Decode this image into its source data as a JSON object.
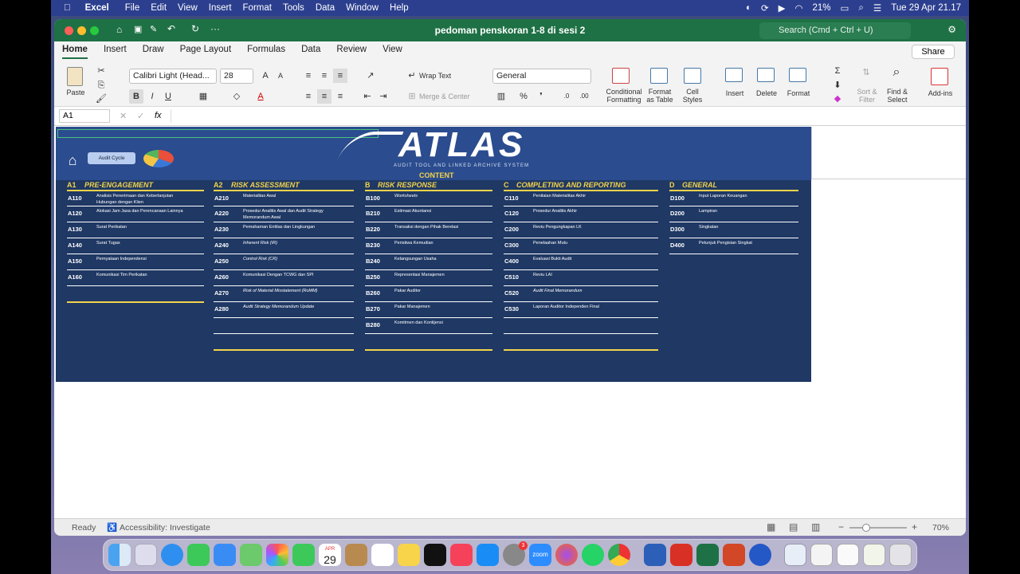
{
  "menubar": {
    "app": "Excel",
    "items": [
      "File",
      "Edit",
      "View",
      "Insert",
      "Format",
      "Tools",
      "Data",
      "Window",
      "Help"
    ],
    "battery": "21%",
    "datetime": "Tue 29 Apr  21.17"
  },
  "window": {
    "title": "pedoman penskoran 1-8 di sesi 2",
    "search_placeholder": "Search (Cmd + Ctrl + U)",
    "share": "Share"
  },
  "ribbon": {
    "tabs": [
      "Home",
      "Insert",
      "Draw",
      "Page Layout",
      "Formulas",
      "Data",
      "Review",
      "View"
    ],
    "paste": "Paste",
    "font": "Calibri Light (Head...",
    "size": "28",
    "wrap": "Wrap Text",
    "merge": "Merge & Center",
    "number_format": "General",
    "cond_fmt_1": "Conditional",
    "cond_fmt_2": "Formatting",
    "fmt_table_1": "Format",
    "fmt_table_2": "as Table",
    "cell_styles_1": "Cell",
    "cell_styles_2": "Styles",
    "insert": "Insert",
    "delete": "Delete",
    "format": "Format",
    "sort_1": "Sort &",
    "sort_2": "Filter",
    "find_1": "Find &",
    "find_2": "Select",
    "addins": "Add-ins"
  },
  "formula": {
    "cell": "A1",
    "fx": "fx"
  },
  "dashboard": {
    "logo": "ATLAS",
    "logo_sub": "AUDIT TOOL AND LINKED ARCHIVE SYSTEM",
    "content": "CONTENT",
    "audit_cycle": "Audit Cycle",
    "columns": [
      {
        "code": "A1",
        "title": "PRE-ENGAGEMENT",
        "rows": [
          [
            "A110",
            "Analisis Penerimaan dan Keberlanjutan Hubungan dengan Klien"
          ],
          [
            "A120",
            "Alokasi Jam Jasa dan Perencanaan Lainnya"
          ],
          [
            "A130",
            "Surat Perikatan"
          ],
          [
            "A140",
            "Surat Tugas"
          ],
          [
            "A150",
            "Pernyataan Independensi"
          ],
          [
            "A160",
            "Komunikasi Tim Perikatan"
          ]
        ]
      },
      {
        "code": "A2",
        "title": "RISK ASSESSMENT",
        "rows": [
          [
            "A210",
            "Materialitas Awal"
          ],
          [
            "A220",
            "Prosedur Analitis Awal dan Audit Strategy Memorandum Awal"
          ],
          [
            "A230",
            "Pemahaman Entitas dan Lingkungan"
          ],
          [
            "A240",
            "Inherent Risk (IR)"
          ],
          [
            "A250",
            "Control Risk (CR)"
          ],
          [
            "A260",
            "Komunikasi Dengan TCWG dan SPI"
          ],
          [
            "A270",
            "Risk of Material Misstatement (RoMM)"
          ],
          [
            "A280",
            "Audit Strategy Memorandum Update"
          ]
        ]
      },
      {
        "code": "B",
        "title": "RISK RESPONSE",
        "rows": [
          [
            "B100",
            "Worksheets"
          ],
          [
            "B210",
            "Estimasi Akuntansi"
          ],
          [
            "B220",
            "Transaksi dengan Pihak Berelasi"
          ],
          [
            "B230",
            "Peristiwa Kemudian"
          ],
          [
            "B240",
            "Kelangsungan Usaha"
          ],
          [
            "B250",
            "Representasi Manajemen"
          ],
          [
            "B260",
            "Pakar Auditor"
          ],
          [
            "B270",
            "Pakar Manajemen"
          ],
          [
            "B280",
            "Komitmen dan Kontijensi"
          ]
        ]
      },
      {
        "code": "C",
        "title": "COMPLETING AND REPORTING",
        "rows": [
          [
            "C110",
            "Penilaian Materialitas Akhir"
          ],
          [
            "C120",
            "Prosedur Analitis Akhir"
          ],
          [
            "C200",
            "Reviu Pengungkapan LK"
          ],
          [
            "C300",
            "Penelaahan Mutu"
          ],
          [
            "C400",
            "Evaluasi Bukti Audit"
          ],
          [
            "C510",
            "Reviu LAI"
          ],
          [
            "C520",
            "Audit Final Memorandum"
          ],
          [
            "C530",
            "Laporan Auditor Independen Final"
          ]
        ]
      },
      {
        "code": "D",
        "title": "GENERAL",
        "rows": [
          [
            "D100",
            "Input Laporan Keuangan"
          ],
          [
            "D200",
            "Lampiran"
          ],
          [
            "D300",
            "Singkatan"
          ],
          [
            "D400",
            "Petunjuk Pengisian Singkat"
          ]
        ]
      }
    ]
  },
  "status": {
    "ready": "Ready",
    "access": "Accessibility: Investigate",
    "zoom": "70%"
  },
  "dock": {
    "calendar_month": "APR",
    "calendar_day": "29",
    "zoom": "zoom",
    "badge": "3"
  }
}
